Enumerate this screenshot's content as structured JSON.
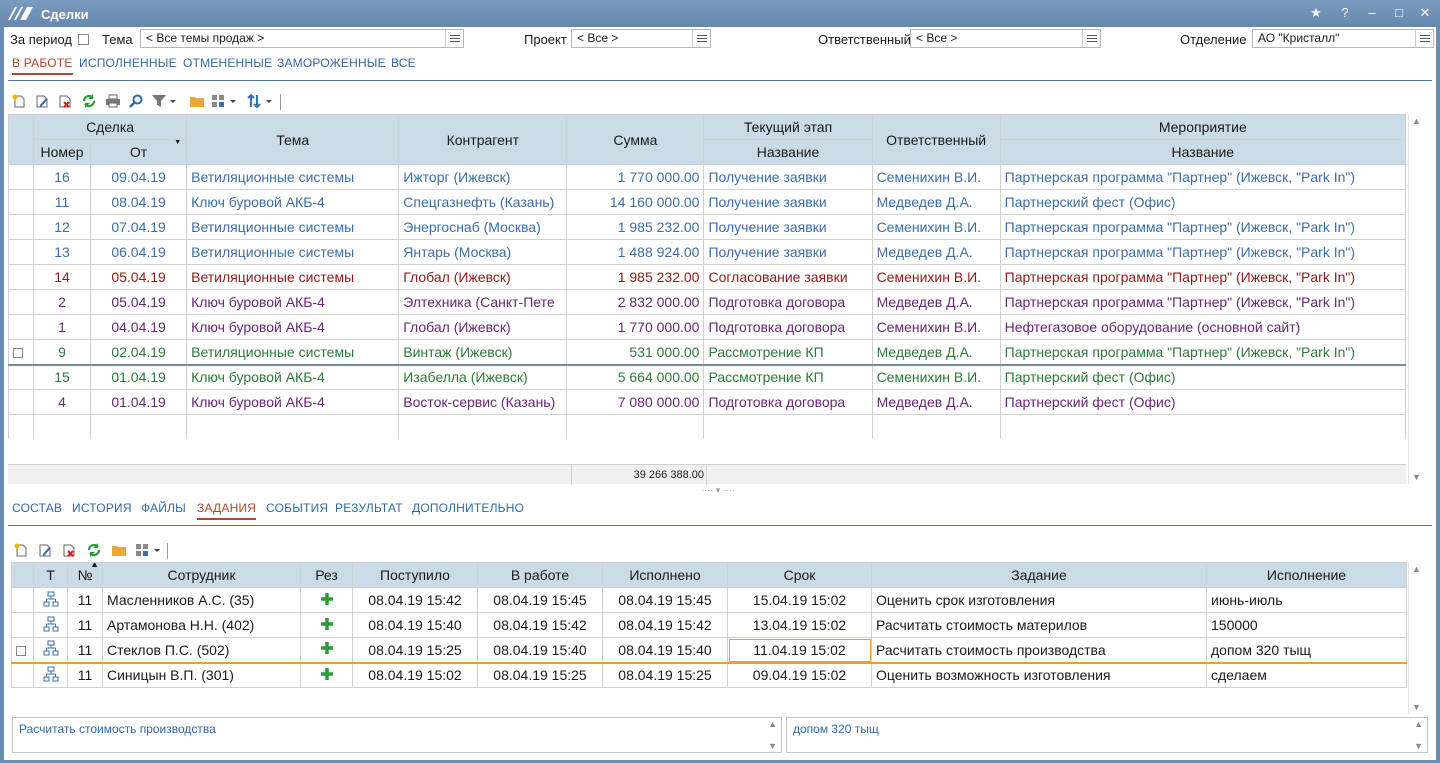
{
  "window": {
    "title": "Сделки",
    "buttons": [
      "★",
      "?",
      "–",
      "□",
      "✕"
    ]
  },
  "filters": {
    "period_label": "За период",
    "theme_label": "Тема",
    "theme_value": "< Все темы продаж >",
    "project_label": "Проект",
    "project_value": "< Все >",
    "responsible_label": "Ответственный",
    "responsible_value": "< Все >",
    "department_label": "Отделение",
    "department_value": "АО \"Кристалл\""
  },
  "status_tabs": [
    "В РАБОТЕ",
    "ИСПОЛНЕННЫЕ",
    "ОТМЕНЕННЫЕ",
    "ЗАМОРОЖЕННЫЕ",
    "ВСЕ"
  ],
  "status_tab_active": "В РАБОТЕ",
  "deals": {
    "headers": {
      "deal_group": "Сделка",
      "number": "Номер",
      "from": "От",
      "theme": "Тема",
      "counterparty": "Контрагент",
      "sum": "Сумма",
      "stage_group": "Текущий этап",
      "stage_name": "Название",
      "responsible": "Ответственный",
      "event_group": "Мероприятие",
      "event_name": "Название"
    },
    "rows": [
      {
        "color": "blue",
        "number": "16",
        "from": "09.04.19",
        "theme": "Ветиляционные системы",
        "counterparty": "Ижторг (Ижевск)",
        "sum": "1 770 000.00",
        "stage": "Получение заявки",
        "responsible": "Семенихин В.И.",
        "event": "Партнерская программа \"Партнер\" (Ижевск, \"Park In\")"
      },
      {
        "color": "blue",
        "number": "11",
        "from": "08.04.19",
        "theme": "Ключ буровой АКБ-4",
        "counterparty": "Спецгазнефть (Казань)",
        "sum": "14 160 000.00",
        "stage": "Получение заявки",
        "responsible": "Медведев Д.А.",
        "event": "Партнерский фест (Офис)"
      },
      {
        "color": "blue",
        "number": "12",
        "from": "07.04.19",
        "theme": "Ветиляционные системы",
        "counterparty": "Энергоснаб (Москва)",
        "sum": "1 985 232.00",
        "stage": "Получение заявки",
        "responsible": "Семенихин В.И.",
        "event": "Партнерская программа \"Партнер\" (Ижевск, \"Park In\")"
      },
      {
        "color": "blue",
        "number": "13",
        "from": "06.04.19",
        "theme": "Ветиляционные системы",
        "counterparty": "Янтарь (Москва)",
        "sum": "1 488 924.00",
        "stage": "Получение заявки",
        "responsible": "Медведев Д.А.",
        "event": "Партнерская программа \"Партнер\" (Ижевск, \"Park In\")"
      },
      {
        "color": "red",
        "number": "14",
        "from": "05.04.19",
        "theme": "Ветиляционные системы",
        "counterparty": "Глобал (Ижевск)",
        "sum": "1 985 232.00",
        "stage": "Согласование заявки",
        "responsible": "Семенихин В.И.",
        "event": "Партнерская программа \"Партнер\" (Ижевск, \"Park In\")"
      },
      {
        "color": "purple",
        "number": "2",
        "from": "05.04.19",
        "theme": "Ключ буровой АКБ-4",
        "counterparty": "Элтехника (Санкт-Пете",
        "sum": "2 832 000.00",
        "stage": "Подготовка договора",
        "responsible": "Медведев Д.А.",
        "event": "Партнерская программа \"Партнер\" (Ижевск, \"Park In\")"
      },
      {
        "color": "purple",
        "number": "1",
        "from": "04.04.19",
        "theme": "Ключ буровой АКБ-4",
        "counterparty": "Глобал (Ижевск)",
        "sum": "1 770 000.00",
        "stage": "Подготовка договора",
        "responsible": "Семенихин В.И.",
        "event": "Нефтегазовое оборудование (основной сайт)"
      },
      {
        "color": "green",
        "number": "9",
        "from": "02.04.19",
        "theme": "Ветиляционные системы",
        "counterparty": "Винтаж (Ижевск)",
        "sum": "531 000.00",
        "stage": "Рассмотрение КП",
        "responsible": "Медведев Д.А.",
        "event": "Партнерская программа \"Партнер\" (Ижевск, \"Park In\")"
      },
      {
        "color": "green",
        "number": "15",
        "from": "01.04.19",
        "theme": "Ключ буровой АКБ-4",
        "counterparty": "Изабелла (Ижевск)",
        "sum": "5 664 000.00",
        "stage": "Рассмотрение КП",
        "responsible": "Семенихин В.И.",
        "event": "Партнерский фест (Офис)"
      },
      {
        "color": "purple",
        "number": "4",
        "from": "01.04.19",
        "theme": "Ключ буровой АКБ-4",
        "counterparty": "Восток-сервис (Казань)",
        "sum": "7 080 000.00",
        "stage": "Подготовка договора",
        "responsible": "Медведев Д.А.",
        "event": "Партнерский фест (Офис)"
      }
    ],
    "total_sum": "39 266 388.00"
  },
  "detail_tabs": [
    "СОСТАВ",
    "ИСТОРИЯ",
    "ФАЙЛЫ",
    "ЗАДАНИЯ",
    "СОБЫТИЯ",
    "РЕЗУЛЬТАТ",
    "ДОПОЛНИТЕЛЬНО"
  ],
  "detail_tab_active": "ЗАДАНИЯ",
  "tasks": {
    "headers": {
      "type": "Т",
      "no": "№",
      "employee": "Сотрудник",
      "res": "Рез",
      "received": "Поступило",
      "in_work": "В работе",
      "done": "Исполнено",
      "deadline": "Срок",
      "task": "Задание",
      "execution": "Исполнение"
    },
    "rows": [
      {
        "no": "11",
        "employee": "Масленников А.С. (35)",
        "received": "08.04.19 15:42",
        "in_work": "08.04.19 15:45",
        "done": "08.04.19 15:45",
        "deadline": "15.04.19 15:02",
        "task": "Оценить срок изготовления",
        "execution": "июнь-июль"
      },
      {
        "no": "11",
        "employee": "Артамонова Н.Н. (402)",
        "received": "08.04.19 15:40",
        "in_work": "08.04.19 15:42",
        "done": "08.04.19 15:42",
        "deadline": "13.04.19 15:02",
        "task": "Расчитать стоимость материлов",
        "execution": "150000"
      },
      {
        "no": "11",
        "employee": "Стеклов П.С. (502)",
        "received": "08.04.19 15:25",
        "in_work": "08.04.19 15:40",
        "done": "08.04.19 15:40",
        "deadline": "11.04.19 15:02",
        "task": "Расчитать стоимость производства",
        "execution": "допом 320 тыщ"
      },
      {
        "no": "11",
        "employee": "Синицын В.П. (301)",
        "received": "08.04.19 15:02",
        "in_work": "08.04.19 15:25",
        "done": "08.04.19 15:25",
        "deadline": "09.04.19 15:02",
        "task": "Оценить возможность изготовления",
        "execution": "сделаем"
      }
    ]
  },
  "memo": {
    "task_text": "Расчитать стоимость производства",
    "execution_text": "допом 320 тыщ"
  },
  "colors": {
    "accent": "#2f6aa8",
    "active_tab": "#b0482a",
    "header_bg": "#c9dbe6",
    "row_blue": "#3d6ea6",
    "row_red": "#8e1b1b",
    "row_purple": "#6a2677",
    "row_green": "#2d7a3a"
  }
}
